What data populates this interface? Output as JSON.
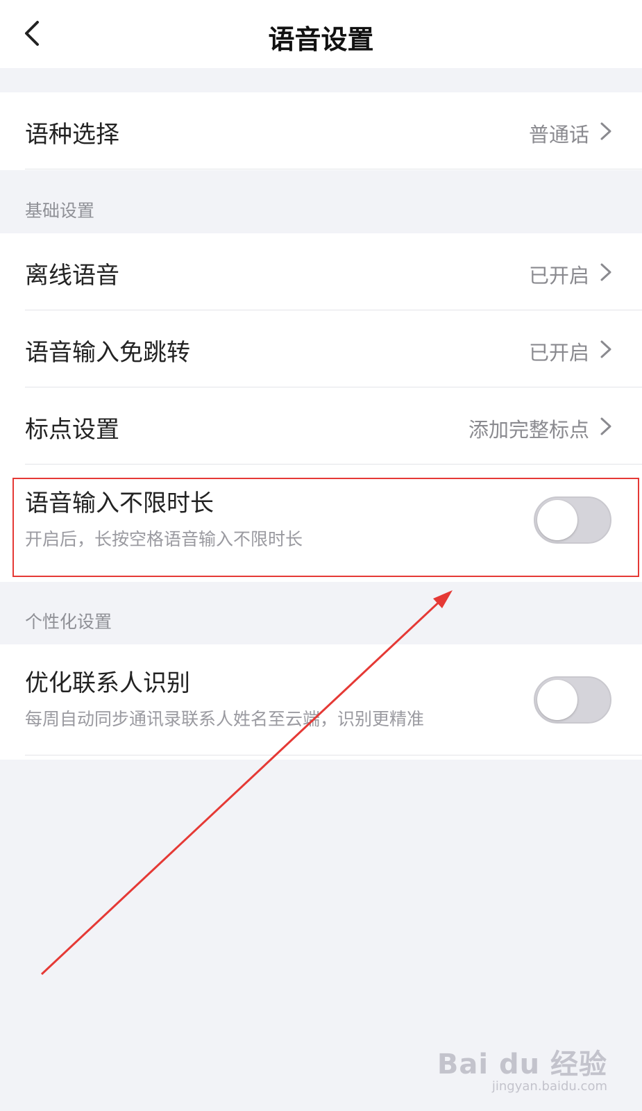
{
  "header": {
    "title": "语音设置",
    "back_icon": "chevron-left-icon"
  },
  "language": {
    "label": "语种选择",
    "value": "普通话"
  },
  "basic_section": {
    "label": "基础设置",
    "items": [
      {
        "label": "离线语音",
        "value": "已开启"
      },
      {
        "label": "语音输入免跳转",
        "value": "已开启"
      },
      {
        "label": "标点设置",
        "value": "添加完整标点"
      }
    ],
    "unlimited": {
      "title": "语音输入不限时长",
      "description": "开启后，长按空格语音输入不限时长",
      "enabled": false
    }
  },
  "personal_section": {
    "label": "个性化设置",
    "contacts": {
      "title": "优化联系人识别",
      "description": "每周自动同步通讯录联系人姓名至云端，识别更精准",
      "enabled": false
    }
  },
  "annotation_color": "#e53935",
  "watermark": {
    "logo": "Bai du 经验",
    "url": "jingyan.baidu.com"
  }
}
